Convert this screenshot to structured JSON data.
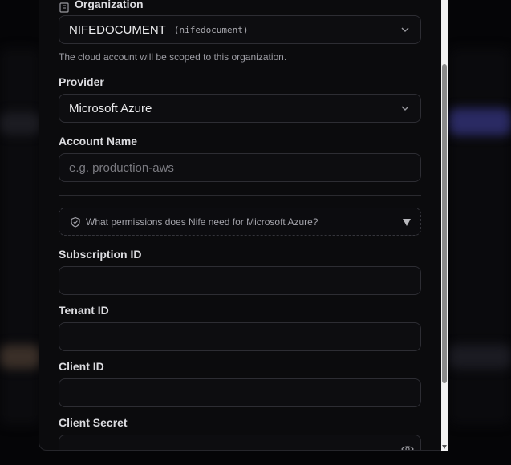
{
  "organization": {
    "label": "Organization",
    "selected_name": "NIFEDOCUMENT",
    "selected_slug": "(nifedocument)",
    "help": "The cloud account will be scoped to this organization."
  },
  "provider": {
    "label": "Provider",
    "selected": "Microsoft Azure"
  },
  "account_name": {
    "label": "Account Name",
    "placeholder": "e.g. production-aws",
    "value": ""
  },
  "permissions": {
    "text": "What permissions does Nife need for Microsoft Azure?"
  },
  "subscription_id": {
    "label": "Subscription ID",
    "value": ""
  },
  "tenant_id": {
    "label": "Tenant ID",
    "value": ""
  },
  "client_id": {
    "label": "Client ID",
    "value": ""
  },
  "client_secret": {
    "label": "Client Secret",
    "value": ""
  },
  "icons": {
    "organization": "building-icon",
    "permissions": "shield-icon",
    "toggle_secret": "eye-icon",
    "dropdown": "chevron-down-icon",
    "expand": "triangle-down-icon"
  }
}
